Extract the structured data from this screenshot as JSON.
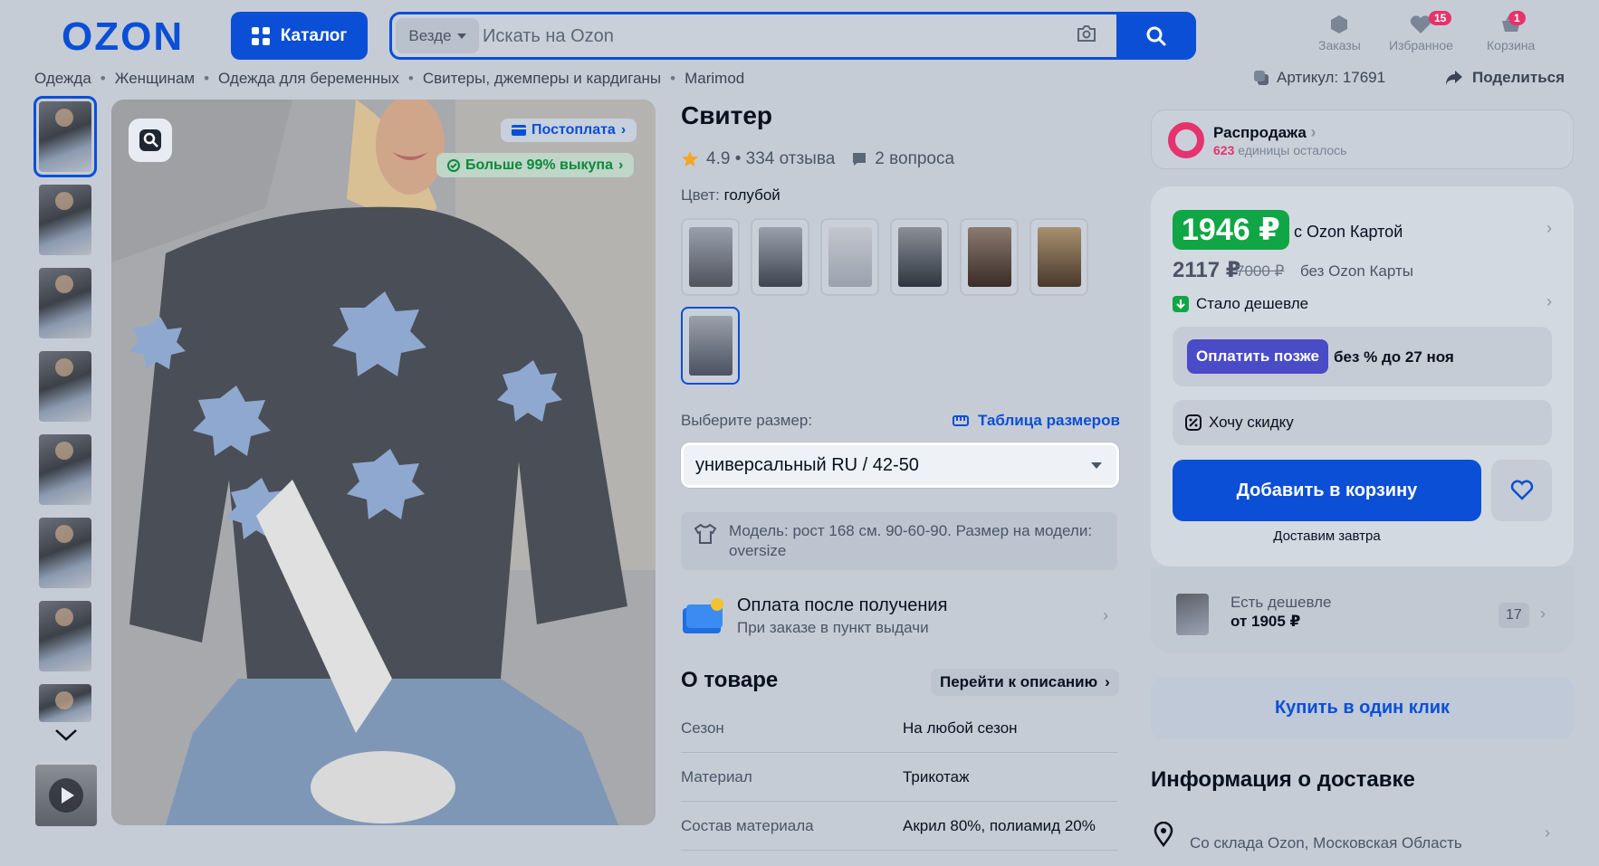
{
  "header": {
    "logo": "OZON",
    "catalog_label": "Каталог",
    "search_scope": "Везде",
    "search_placeholder": "Искать на Ozon",
    "orders_label": "Заказы",
    "favorites_label": "Избранное",
    "favorites_count": "15",
    "cart_label": "Корзина",
    "cart_count": "1"
  },
  "breadcrumbs": [
    "Одежда",
    "Женщинам",
    "Одежда для беременных",
    "Свитеры, джемперы и кардиганы",
    "Marimod"
  ],
  "sku_label": "Артикул: 17691",
  "share_label": "Поделиться",
  "gallery": {
    "thumb_count": 8,
    "tag_postpay": "Постоплата",
    "tag_buyout": "Больше 99% выкупа",
    "icons": [
      "lens-search-icon",
      "chevron-down-icon",
      "play-icon"
    ]
  },
  "product": {
    "title": "Свитер",
    "rating": "4.9 • 334 отзыва",
    "questions": "2 вопроса",
    "color_label": "Цвет:",
    "color_value": "голубой",
    "swatch_colors": [
      "#4e535c",
      "#3d4550",
      "#9aa1ad",
      "#2f3641",
      "#3a2c27",
      "#4a3a2c",
      "#4b5360"
    ],
    "size_label": "Выберите размер:",
    "size_table_label": "Таблица размеров",
    "size_selected": "универсальный RU / 42-50",
    "model_info": "Модель: рост 168 см. 90-60-90. Размер на модели: oversize",
    "pay_after_title": "Оплата после получения",
    "pay_after_sub": "При заказе в пункт выдачи",
    "about_title": "О товаре",
    "to_description": "Перейти к описанию",
    "properties": [
      {
        "k": "Сезон",
        "v": "На любой сезон"
      },
      {
        "k": "Материал",
        "v": "Трикотаж"
      },
      {
        "k": "Состав материала",
        "v": "Акрил 80%, полиамид 20%"
      }
    ]
  },
  "buybox": {
    "sale_title": "Распродажа",
    "sale_count": "623",
    "sale_rest": "единицы осталось",
    "price_card": "1946 ₽",
    "price_card_label": "с Ozon Картой",
    "price_regular": "2117 ₽",
    "price_old": "7000 ₽",
    "price_regular_label": "без Ozon Карты",
    "cheaper_label": "Стало дешевле",
    "pay_later_btn": "Оплатить позже",
    "pay_later_text": "без % до 27 ноя",
    "want_discount": "Хочу скидку",
    "add_to_cart": "Добавить в корзину",
    "deliver_tomorrow": "Доставим завтра",
    "cheaper_exists": "Есть дешевле",
    "cheaper_from": "от 1905 ₽",
    "cheaper_count": "17",
    "one_click": "Купить в один клик",
    "delivery_title": "Информация о доставке",
    "delivery_from": "Со склада Ozon, Московская Область"
  },
  "colors": {
    "accent": "#0b4fd6",
    "green": "#10a646",
    "pink": "#e5336d",
    "purple": "#4a4bc7",
    "background": "#c5ccd6"
  }
}
